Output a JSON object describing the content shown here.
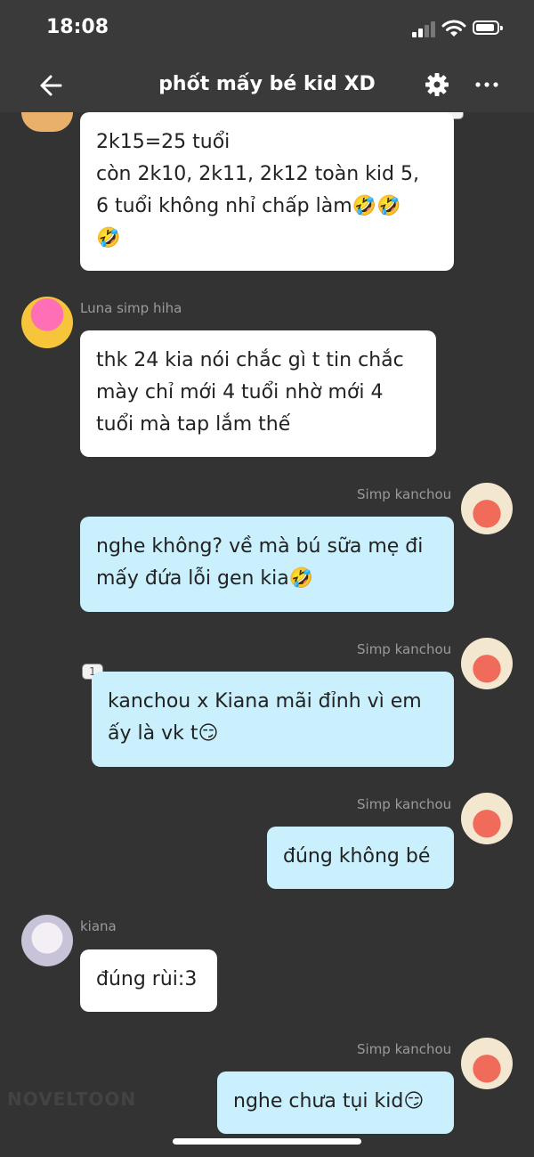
{
  "status_bar": {
    "time": "18:08"
  },
  "header": {
    "title": "phốt mấy bé kid XD"
  },
  "messages": [
    {
      "side": "left",
      "lines": [
        "2k15=25 tuổi",
        "còn 2k10, 2k11, 2k12 toàn kid 5,",
        "6 tuổi không nhỉ chấp làm🤣🤣",
        "🤣"
      ]
    },
    {
      "side": "left",
      "sender": "Luna simp hiha",
      "lines": [
        "thk 24 kia nói chắc gì t tin chắc",
        "mày chỉ mới 4 tuổi nhờ mới 4",
        "tuổi mà tap lắm thế"
      ]
    },
    {
      "side": "right",
      "sender": "Simp kanchou",
      "lines": [
        "nghe không? về mà bú sữa mẹ đi",
        "mấy đứa lỗi gen kia🤣"
      ]
    },
    {
      "side": "right",
      "sender": "Simp kanchou",
      "reply_count": "1",
      "lines": [
        "kanchou x Kiana mãi đỉnh vì em",
        "ấy là vk t😏"
      ]
    },
    {
      "side": "right",
      "sender": "Simp kanchou",
      "lines": [
        "đúng không bé"
      ]
    },
    {
      "side": "left",
      "sender": "kiana",
      "lines": [
        "đúng rùi:3"
      ]
    },
    {
      "side": "right",
      "sender": "Simp kanchou",
      "lines": [
        "nghe chưa tụi kid😏"
      ]
    }
  ],
  "watermark": "NOVELTOON",
  "colors": {
    "background": "#333333",
    "incoming_bubble": "#ffffff",
    "outgoing_bubble": "#c9f0fc",
    "sender_name": "#9a9a9a"
  },
  "icons": [
    "back-arrow-icon",
    "settings-gear-icon",
    "more-dots-icon",
    "signal-icon",
    "wifi-icon",
    "battery-icon"
  ]
}
